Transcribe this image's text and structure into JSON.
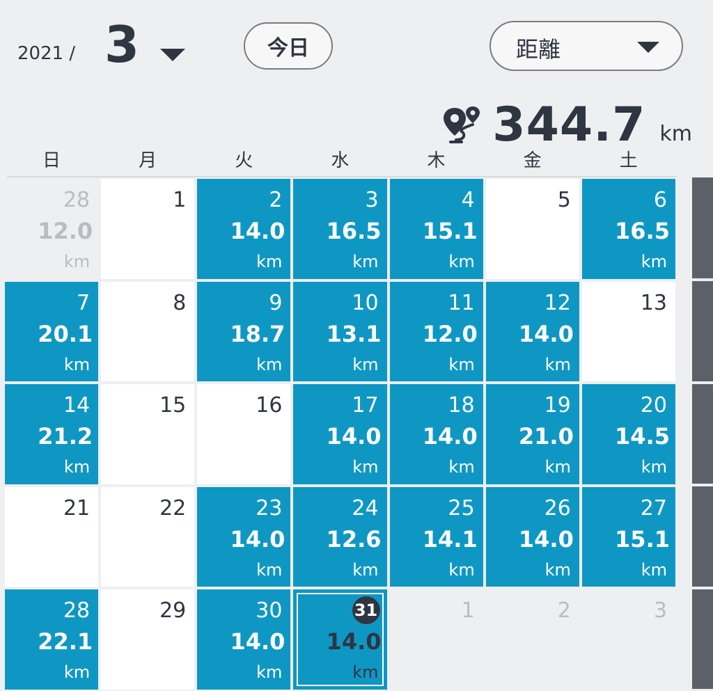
{
  "header": {
    "year": "2021 /",
    "month": "3",
    "today_label": "今日",
    "metric_label": "距離"
  },
  "total": {
    "value": "344.7",
    "unit": "km",
    "icon": "route-pin-icon"
  },
  "weekdays": [
    "日",
    "月",
    "火",
    "水",
    "木",
    "金",
    "土"
  ],
  "colors": {
    "active": "#0f97c4",
    "text": "#2f3541",
    "muted": "#b9bcc2",
    "background": "#eeeff1"
  },
  "weeks": [
    [
      {
        "day": "28",
        "dist": "12.0",
        "unit": "km",
        "state": "other"
      },
      {
        "day": "1",
        "dist": "",
        "unit": "",
        "state": "inactive"
      },
      {
        "day": "2",
        "dist": "14.0",
        "unit": "km",
        "state": "active"
      },
      {
        "day": "3",
        "dist": "16.5",
        "unit": "km",
        "state": "active"
      },
      {
        "day": "4",
        "dist": "15.1",
        "unit": "km",
        "state": "active"
      },
      {
        "day": "5",
        "dist": "",
        "unit": "",
        "state": "inactive"
      },
      {
        "day": "6",
        "dist": "16.5",
        "unit": "km",
        "state": "active"
      }
    ],
    [
      {
        "day": "7",
        "dist": "20.1",
        "unit": "km",
        "state": "active"
      },
      {
        "day": "8",
        "dist": "",
        "unit": "",
        "state": "inactive"
      },
      {
        "day": "9",
        "dist": "18.7",
        "unit": "km",
        "state": "active"
      },
      {
        "day": "10",
        "dist": "13.1",
        "unit": "km",
        "state": "active"
      },
      {
        "day": "11",
        "dist": "12.0",
        "unit": "km",
        "state": "active"
      },
      {
        "day": "12",
        "dist": "14.0",
        "unit": "km",
        "state": "active"
      },
      {
        "day": "13",
        "dist": "",
        "unit": "",
        "state": "inactive"
      }
    ],
    [
      {
        "day": "14",
        "dist": "21.2",
        "unit": "km",
        "state": "active"
      },
      {
        "day": "15",
        "dist": "",
        "unit": "",
        "state": "inactive"
      },
      {
        "day": "16",
        "dist": "",
        "unit": "",
        "state": "inactive"
      },
      {
        "day": "17",
        "dist": "14.0",
        "unit": "km",
        "state": "active"
      },
      {
        "day": "18",
        "dist": "14.0",
        "unit": "km",
        "state": "active"
      },
      {
        "day": "19",
        "dist": "21.0",
        "unit": "km",
        "state": "active"
      },
      {
        "day": "20",
        "dist": "14.5",
        "unit": "km",
        "state": "active"
      }
    ],
    [
      {
        "day": "21",
        "dist": "",
        "unit": "",
        "state": "inactive"
      },
      {
        "day": "22",
        "dist": "",
        "unit": "",
        "state": "inactive"
      },
      {
        "day": "23",
        "dist": "14.0",
        "unit": "km",
        "state": "active"
      },
      {
        "day": "24",
        "dist": "12.6",
        "unit": "km",
        "state": "active"
      },
      {
        "day": "25",
        "dist": "14.1",
        "unit": "km",
        "state": "active"
      },
      {
        "day": "26",
        "dist": "14.0",
        "unit": "km",
        "state": "active"
      },
      {
        "day": "27",
        "dist": "15.1",
        "unit": "km",
        "state": "active"
      }
    ],
    [
      {
        "day": "28",
        "dist": "22.1",
        "unit": "km",
        "state": "active"
      },
      {
        "day": "29",
        "dist": "",
        "unit": "",
        "state": "inactive"
      },
      {
        "day": "30",
        "dist": "14.0",
        "unit": "km",
        "state": "active"
      },
      {
        "day": "31",
        "dist": "14.0",
        "unit": "km",
        "state": "today"
      },
      {
        "day": "1",
        "dist": "",
        "unit": "",
        "state": "other"
      },
      {
        "day": "2",
        "dist": "",
        "unit": "",
        "state": "other"
      },
      {
        "day": "3",
        "dist": "",
        "unit": "",
        "state": "other"
      }
    ]
  ]
}
